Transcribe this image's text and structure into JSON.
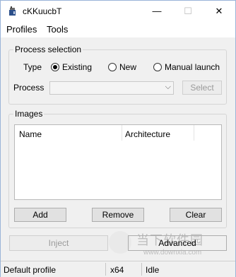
{
  "window": {
    "title": "cKKuucbT",
    "minimize_glyph": "—",
    "maximize_glyph": "☐",
    "close_glyph": "✕"
  },
  "menu": {
    "items": [
      "Profiles",
      "Tools"
    ]
  },
  "process_selection": {
    "group_label": "Process selection",
    "type_label": "Type",
    "options": [
      {
        "label": "Existing",
        "checked": true
      },
      {
        "label": "New",
        "checked": false
      },
      {
        "label": "Manual launch",
        "checked": false
      }
    ],
    "process_label": "Process",
    "process_value": "",
    "dropdown_arrow": "⌵",
    "select_button": "Select"
  },
  "images": {
    "group_label": "Images",
    "columns": [
      "Name",
      "Architecture"
    ],
    "rows": [],
    "add_button": "Add",
    "remove_button": "Remove",
    "clear_button": "Clear"
  },
  "actions": {
    "inject_button": "Inject",
    "advanced_button": "Advanced"
  },
  "watermark": {
    "text": "当下软件园",
    "url": "www.downxia.com"
  },
  "status": {
    "profile": "Default profile",
    "arch": "x64",
    "state": "Idle"
  }
}
